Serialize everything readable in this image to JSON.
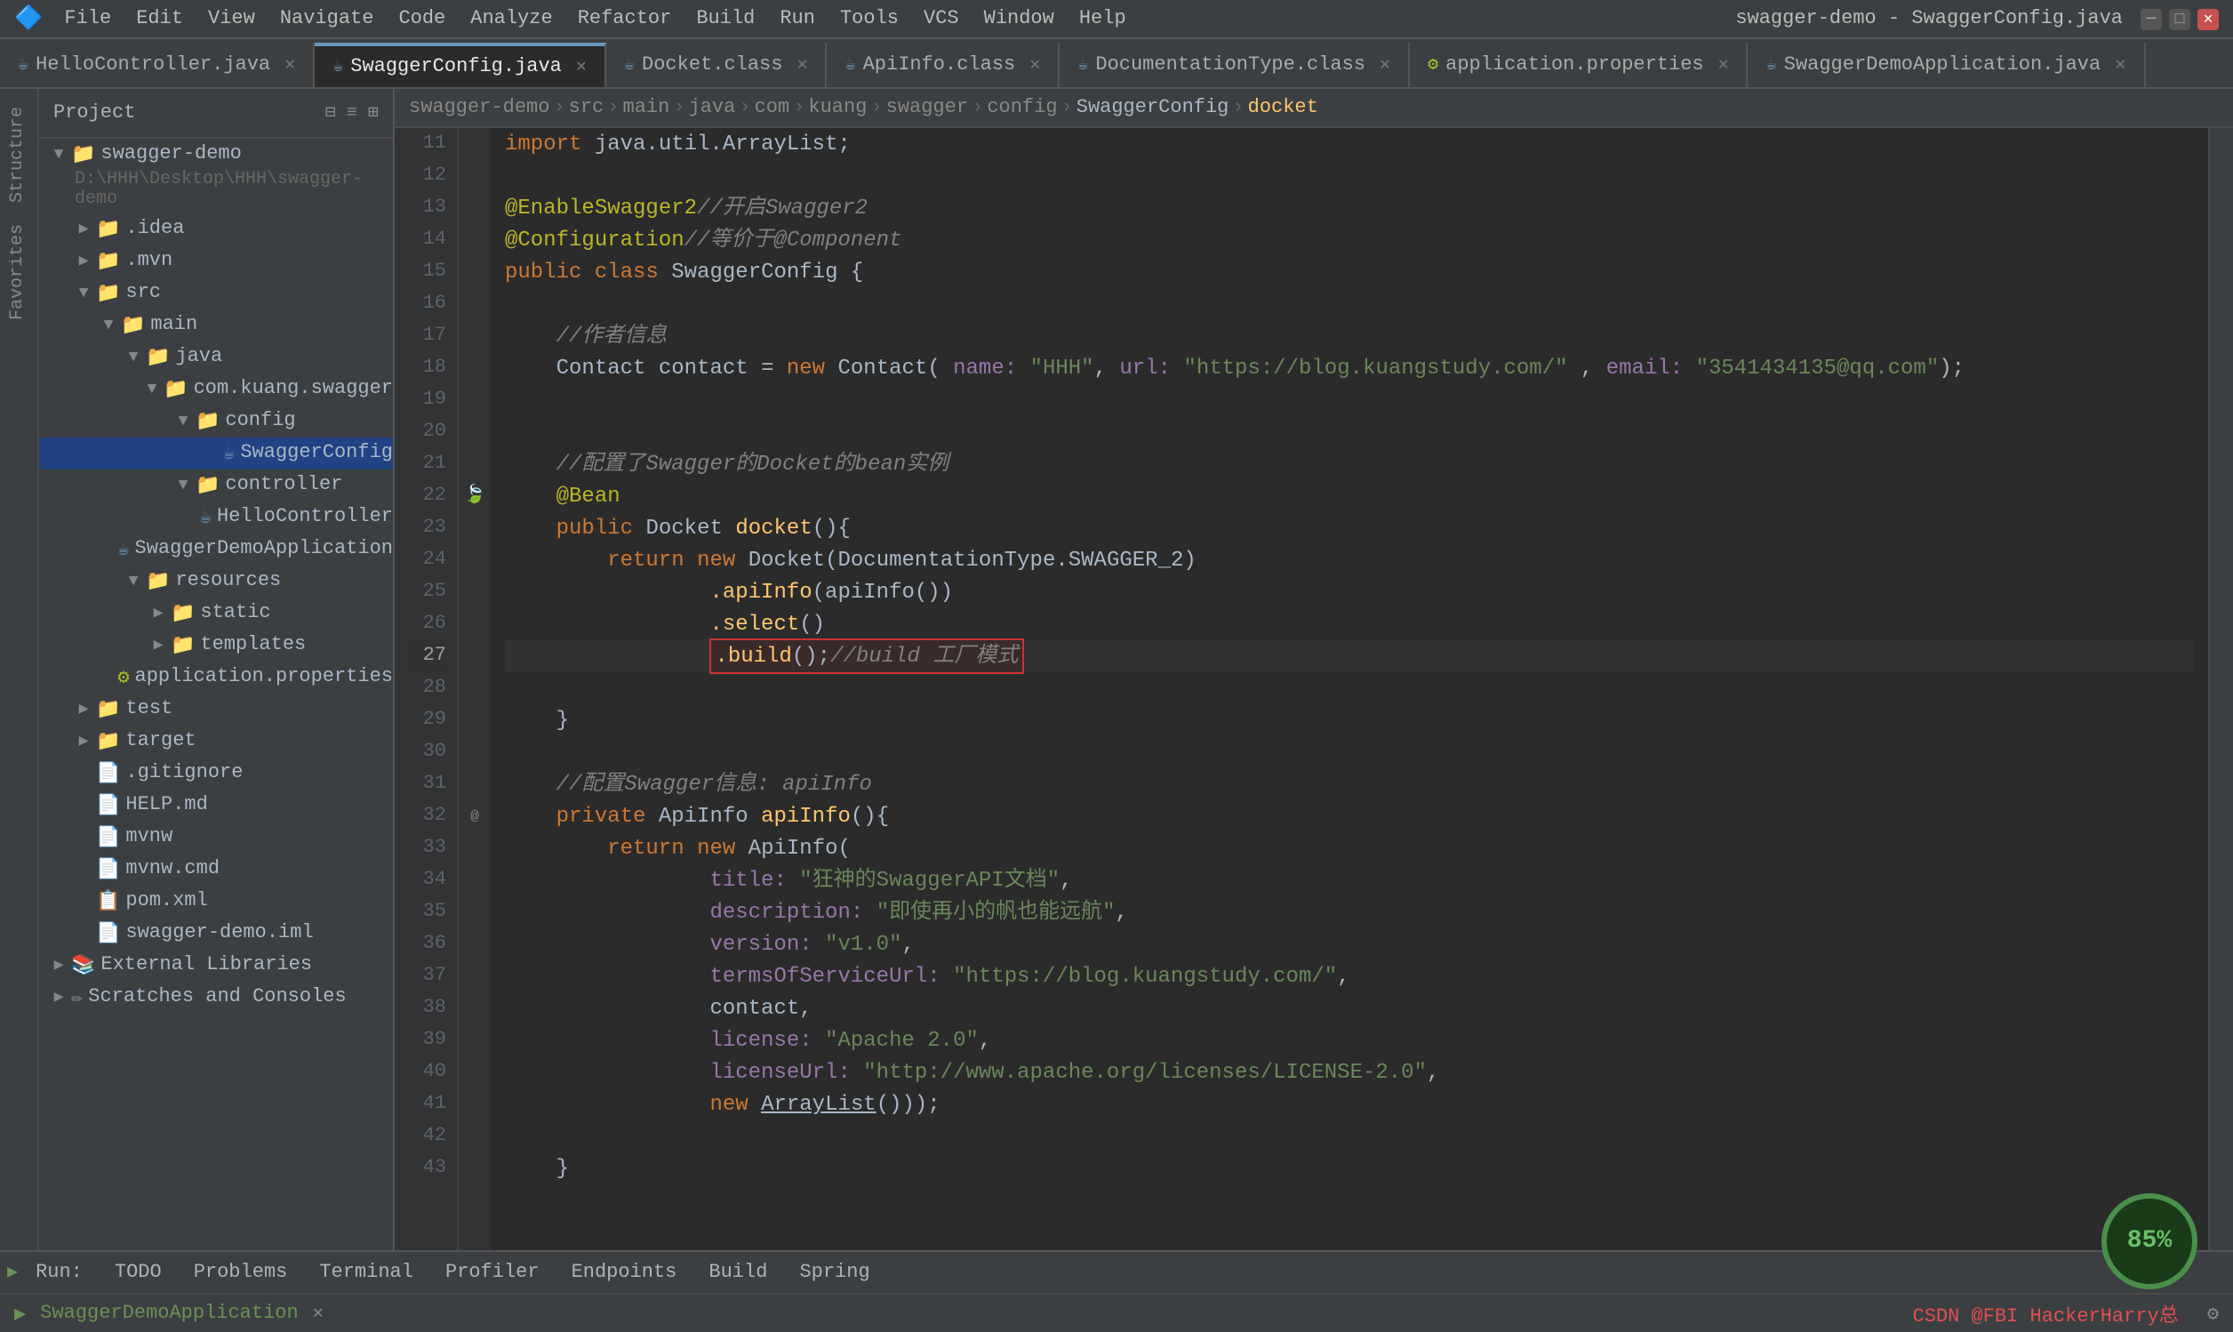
{
  "window": {
    "title": "swagger-demo - SwaggerConfig.java",
    "app_name": "swagger-demo - SwaggerConfig.java"
  },
  "menu": {
    "items": [
      "File",
      "Edit",
      "View",
      "Navigate",
      "Code",
      "Analyze",
      "Refactor",
      "Build",
      "Run",
      "Tools",
      "VCS",
      "Window",
      "Help"
    ]
  },
  "tabs": [
    {
      "label": "HelloController.java",
      "active": false,
      "icon": "java"
    },
    {
      "label": "SwaggerConfig.java",
      "active": true,
      "icon": "java"
    },
    {
      "label": "Docket.class",
      "active": false,
      "icon": "java"
    },
    {
      "label": "ApiInfo.class",
      "active": false,
      "icon": "java"
    },
    {
      "label": "DocumentationType.class",
      "active": false,
      "icon": "java"
    },
    {
      "label": "application.properties",
      "active": false,
      "icon": "prop"
    },
    {
      "label": "SwaggerDemoApplication.java",
      "active": false,
      "icon": "java"
    }
  ],
  "breadcrumb": {
    "parts": [
      "swagger-demo",
      "src",
      "main",
      "java",
      "com",
      "kuang",
      "swagger",
      "config",
      "SwaggerConfig",
      "docket"
    ]
  },
  "sidebar": {
    "project_label": "Project",
    "root": "swagger-demo",
    "root_path": "D:\\HHH\\Desktop\\HHH\\swagger-demo",
    "items": [
      {
        "level": 1,
        "label": ".idea",
        "type": "folder",
        "expanded": false
      },
      {
        "level": 1,
        "label": ".mvn",
        "type": "folder",
        "expanded": false
      },
      {
        "level": 1,
        "label": "src",
        "type": "folder",
        "expanded": true
      },
      {
        "level": 2,
        "label": "main",
        "type": "folder",
        "expanded": true
      },
      {
        "level": 3,
        "label": "java",
        "type": "folder",
        "expanded": true
      },
      {
        "level": 4,
        "label": "com.kuang.swagger",
        "type": "folder",
        "expanded": true
      },
      {
        "level": 5,
        "label": "config",
        "type": "folder",
        "expanded": true
      },
      {
        "level": 6,
        "label": "SwaggerConfig",
        "type": "java",
        "selected": true
      },
      {
        "level": 5,
        "label": "controller",
        "type": "folder",
        "expanded": true
      },
      {
        "level": 6,
        "label": "HelloController",
        "type": "java"
      },
      {
        "level": 5,
        "label": "SwaggerDemoApplication",
        "type": "java"
      },
      {
        "level": 3,
        "label": "resources",
        "type": "folder",
        "expanded": true
      },
      {
        "level": 4,
        "label": "static",
        "type": "folder"
      },
      {
        "level": 4,
        "label": "templates",
        "type": "folder"
      },
      {
        "level": 4,
        "label": "application.properties",
        "type": "prop"
      },
      {
        "level": 2,
        "label": "test",
        "type": "folder",
        "expanded": false
      },
      {
        "level": 1,
        "label": "target",
        "type": "folder",
        "expanded": false
      },
      {
        "level": 1,
        "label": ".gitignore",
        "type": "file"
      },
      {
        "level": 1,
        "label": "HELP.md",
        "type": "file"
      },
      {
        "level": 1,
        "label": "mvnw",
        "type": "file"
      },
      {
        "level": 1,
        "label": "mvnw.cmd",
        "type": "file"
      },
      {
        "level": 1,
        "label": "pom.xml",
        "type": "xml"
      },
      {
        "level": 1,
        "label": "swagger-demo.iml",
        "type": "file"
      },
      {
        "level": 1,
        "label": "External Libraries",
        "type": "folder",
        "expanded": false
      },
      {
        "level": 1,
        "label": "Scratches and Consoles",
        "type": "folder"
      }
    ]
  },
  "code": {
    "lines": [
      {
        "num": 11,
        "content": "import java.util.ArrayList;",
        "tokens": [
          {
            "text": "import ",
            "cls": "kw"
          },
          {
            "text": "java.util.ArrayList",
            "cls": ""
          },
          {
            "text": ";",
            "cls": ""
          }
        ]
      },
      {
        "num": 12,
        "content": ""
      },
      {
        "num": 13,
        "content": "@EnableSwagger2//开启Swagger2"
      },
      {
        "num": 14,
        "content": "@Configuration//等价于@Component"
      },
      {
        "num": 15,
        "content": "public class SwaggerConfig {"
      },
      {
        "num": 16,
        "content": ""
      },
      {
        "num": 17,
        "content": "    //作者信息",
        "comment": true
      },
      {
        "num": 18,
        "content": "    Contact contact = new Contact( name: \"HHH\", url: \"https://blog.kuangstudy.com/\" , email: \"3541434135@qq.com\");"
      },
      {
        "num": 19,
        "content": ""
      },
      {
        "num": 20,
        "content": ""
      },
      {
        "num": 21,
        "content": "    //配置了Swagger的Docket的bean实例",
        "comment": true
      },
      {
        "num": 22,
        "content": "    @Bean"
      },
      {
        "num": 23,
        "content": "    public Docket docket(){"
      },
      {
        "num": 24,
        "content": "        return new Docket(DocumentationType.SWAGGER_2)"
      },
      {
        "num": 25,
        "content": "                .apiInfo(apiInfo())"
      },
      {
        "num": 26,
        "content": "                .select()"
      },
      {
        "num": 27,
        "content": "                .build();//build 工厂模式",
        "highlighted": true
      },
      {
        "num": 28,
        "content": ""
      },
      {
        "num": 29,
        "content": "    }"
      },
      {
        "num": 30,
        "content": ""
      },
      {
        "num": 31,
        "content": "    //配置Swagger信息: apiInfo",
        "comment": true
      },
      {
        "num": 32,
        "content": "    private ApiInfo apiInfo(){"
      },
      {
        "num": 33,
        "content": "        return new ApiInfo("
      },
      {
        "num": 34,
        "content": "                title: \"狂神的SwaggerAPI文档\","
      },
      {
        "num": 35,
        "content": "                description: \"即使再小的帆也能远航\","
      },
      {
        "num": 36,
        "content": "                version: \"v1.0\","
      },
      {
        "num": 37,
        "content": "                termsOfServiceUrl: \"https://blog.kuangstudy.com/\","
      },
      {
        "num": 38,
        "content": "                contact,"
      },
      {
        "num": 39,
        "content": "                license: \"Apache 2.0\","
      },
      {
        "num": 40,
        "content": "                licenseUrl: \"http://www.apache.org/licenses/LICENSE-2.0\","
      },
      {
        "num": 41,
        "content": "                new ArrayList());"
      },
      {
        "num": 42,
        "content": ""
      },
      {
        "num": 43,
        "content": "    }"
      }
    ]
  },
  "status_bar": {
    "run_label": "Run:",
    "app_label": "SwaggerDemoApplication",
    "todo_label": "TODO",
    "problems_label": "Problems",
    "terminal_label": "Terminal",
    "profiler_label": "Profiler",
    "endpoints_label": "Endpoints",
    "build_label": "Build",
    "spring_label": "Spring",
    "csdn_label": "CSDN @FBI HackerHarry总",
    "run_icon": "▶",
    "perf_value": "85%"
  }
}
